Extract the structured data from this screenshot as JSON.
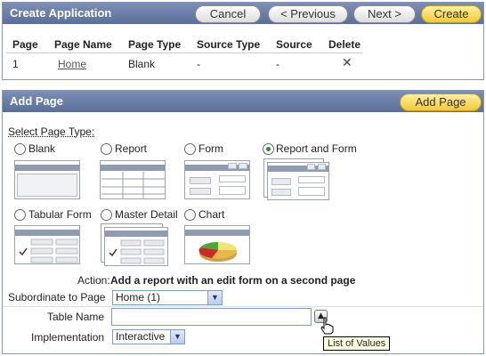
{
  "create_app": {
    "title": "Create Application",
    "buttons": {
      "cancel": "Cancel",
      "previous": "< Previous",
      "next": "Next >",
      "create": "Create"
    },
    "columns": [
      "Page",
      "Page Name",
      "Page Type",
      "Source Type",
      "Source",
      "Delete"
    ],
    "row": {
      "page": "1",
      "page_name": "Home",
      "page_type": "Blank",
      "source_type": "-",
      "source": "-"
    }
  },
  "add_page": {
    "title": "Add Page",
    "add_button": "Add Page",
    "select_label": "Select Page Type:",
    "types": {
      "blank": "Blank",
      "report": "Report",
      "form": "Form",
      "report_and_form": "Report and Form",
      "tabular_form": "Tabular Form",
      "master_detail": "Master Detail",
      "chart": "Chart"
    },
    "selected_type": "Report and Form",
    "action_label": "Action:",
    "action_text": "Add a report with an edit form on a second page",
    "subordinate_label": "Subordinate to Page",
    "subordinate_value": "Home (1)",
    "table_name_label": "Table Name",
    "table_name_value": "",
    "implementation_label": "Implementation",
    "implementation_value": "Interactive",
    "lov_tooltip": "List of Values"
  }
}
